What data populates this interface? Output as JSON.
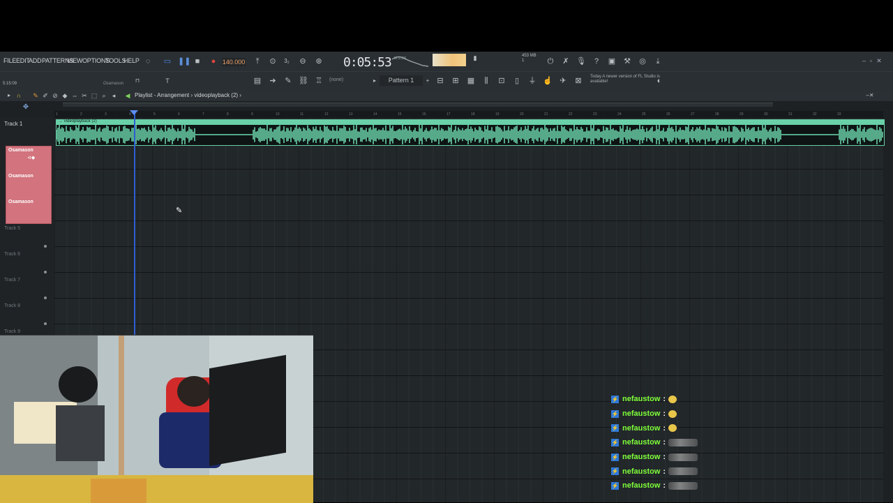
{
  "menu": [
    "FILE",
    "EDIT",
    "ADD",
    "PATTERNS",
    "VIEW",
    "OPTIONS",
    "TOOLS",
    "HELP"
  ],
  "transport": {
    "tempo": "140.000",
    "time": "0:05:53",
    "time_sub": "M:S:CS"
  },
  "system": {
    "mem": "453 MB",
    "cpu": "1"
  },
  "toolbar2": {
    "hint": "Osamason",
    "mode": "(none)",
    "pattern": "Pattern 1",
    "news": "Today  A newer version of FL Studio is available!"
  },
  "playlist": {
    "title": "Playlist - Arrangement › videoplayback (2) ›",
    "position": "5:15:09",
    "ruler_ticks": [
      "1",
      "2",
      "3",
      "4",
      "5",
      "6",
      "7",
      "8",
      "9",
      "10",
      "11",
      "12",
      "13",
      "14",
      "15",
      "16",
      "17",
      "18",
      "19",
      "20",
      "21",
      "22",
      "23",
      "24",
      "25",
      "26",
      "27",
      "28",
      "29",
      "30",
      "31",
      "32",
      "33"
    ]
  },
  "clip": {
    "name": "→ videoplayback (2)",
    "color": "#69d0a8"
  },
  "tracks": {
    "track1": "Track 1",
    "grouped": [
      "Osamason",
      "Osamason",
      "Osamason"
    ],
    "others": [
      "Track 5",
      "Track 6",
      "Track 7",
      "Track 8",
      "Track 9"
    ]
  },
  "chat": [
    {
      "user": "nefaustow",
      "emote": "coin-emote"
    },
    {
      "user": "nefaustow",
      "emote": "coin-emote"
    },
    {
      "user": "nefaustow",
      "emote": "coin-emote"
    },
    {
      "user": "nefaustow",
      "emote": "hand-emote"
    },
    {
      "user": "nefaustow",
      "emote": "hand-emote"
    },
    {
      "user": "nefaustow",
      "emote": "hand-emote"
    },
    {
      "user": "nefaustow",
      "emote": "hand-emote"
    }
  ],
  "colors": {
    "accent_green": "#69d0a8",
    "chat_user": "#7fff3a",
    "playhead": "#2e5fd0",
    "group_red": "#d2737d"
  }
}
